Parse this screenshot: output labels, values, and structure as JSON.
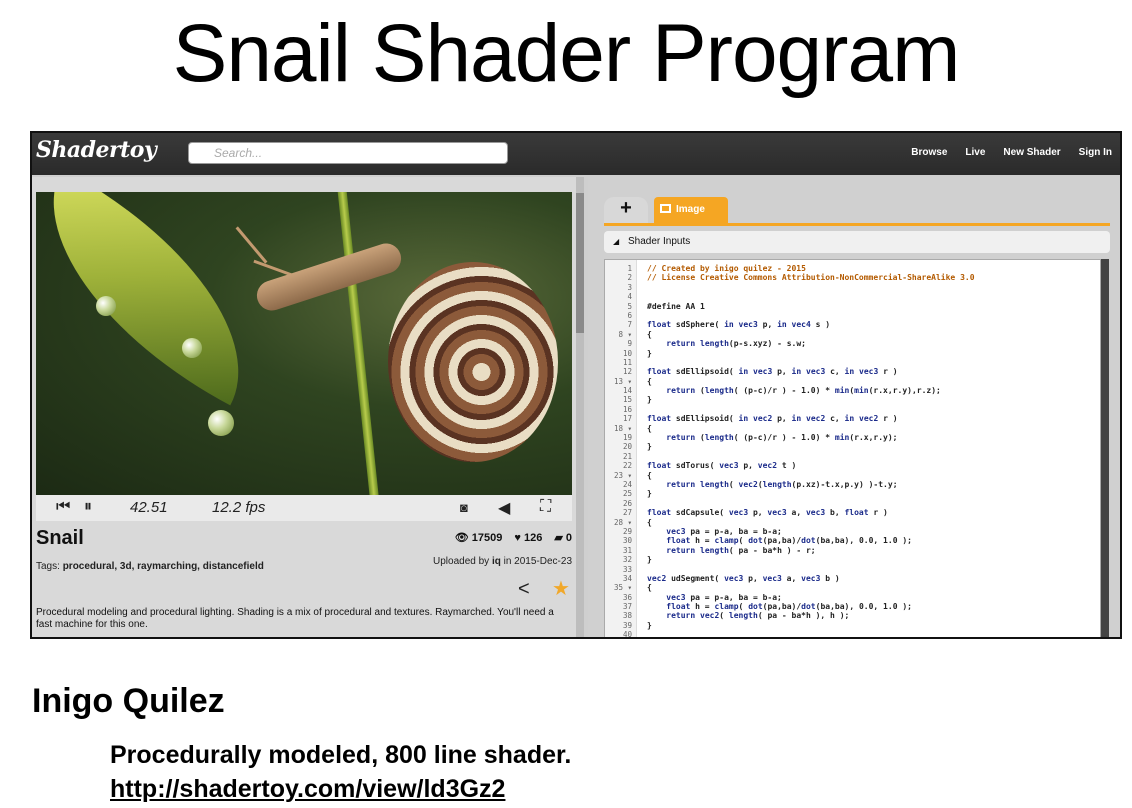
{
  "slide": {
    "title": "Snail Shader Program",
    "author": "Inigo Quilez",
    "description": "Procedurally modeled, 800 line shader.",
    "link": "http://shadertoy.com/view/ld3Gz2"
  },
  "header": {
    "logo": "Shadertoy",
    "search_placeholder": "Search...",
    "nav": [
      "Browse",
      "Live",
      "New Shader",
      "Sign In"
    ]
  },
  "player": {
    "time": "42.51",
    "fps": "12.2 fps",
    "icons": [
      "rewind-icon",
      "pause-icon",
      "vr-icon",
      "volume-icon",
      "fullscreen-icon"
    ]
  },
  "shader": {
    "name": "Snail",
    "tags_label": "Tags:",
    "tags": "procedural, 3d, raymarching, distancefield",
    "views": "17509",
    "likes": "126",
    "comments": "0",
    "uploaded_prefix": "Uploaded by",
    "uploaded_by": "iq",
    "uploaded_suffix": "in 2015-Dec-23",
    "description": "Procedural modeling and procedural lighting. Shading is a mix of procedural and textures. Raymarched. You'll need a fast machine for this one."
  },
  "editor": {
    "tab_add": "+",
    "tab_image": "Image",
    "shader_inputs": "Shader Inputs",
    "lines": [
      "// Created by inigo quilez - 2015",
      "// License Creative Commons Attribution-NonCommercial-ShareAlike 3.0",
      "",
      "",
      "#define AA 1",
      "",
      "float sdSphere( in vec3 p, in vec4 s )",
      "{",
      "    return length(p-s.xyz) - s.w;",
      "}",
      "",
      "float sdEllipsoid( in vec3 p, in vec3 c, in vec3 r )",
      "{",
      "    return (length( (p-c)/r ) - 1.0) * min(min(r.x,r.y),r.z);",
      "}",
      "",
      "float sdEllipsoid( in vec2 p, in vec2 c, in vec2 r )",
      "{",
      "    return (length( (p-c)/r ) - 1.0) * min(r.x,r.y);",
      "}",
      "",
      "float sdTorus( vec3 p, vec2 t )",
      "{",
      "    return length( vec2(length(p.xz)-t.x,p.y) )-t.y;",
      "}",
      "",
      "float sdCapsule( vec3 p, vec3 a, vec3 b, float r )",
      "{",
      "    vec3 pa = p-a, ba = b-a;",
      "    float h = clamp( dot(pa,ba)/dot(ba,ba), 0.0, 1.0 );",
      "    return length( pa - ba*h ) - r;",
      "}",
      "",
      "vec2 udSegment( vec3 p, vec3 a, vec3 b )",
      "{",
      "    vec3 pa = p-a, ba = b-a;",
      "    float h = clamp( dot(pa,ba)/dot(ba,ba), 0.0, 1.0 );",
      "    return vec2( length( pa - ba*h ), h );",
      "}",
      ""
    ],
    "fold_lines": [
      8,
      13,
      18,
      23,
      28,
      35
    ]
  },
  "colors": {
    "accent": "#f5a623",
    "topbar": "#2e2e2e",
    "comment": "#b35a00",
    "keyword": "#1a2a8a"
  }
}
